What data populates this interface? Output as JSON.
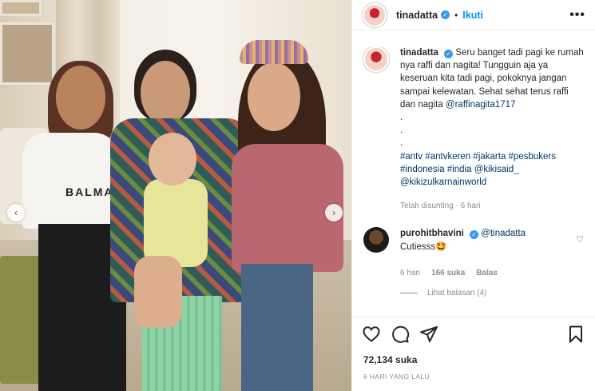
{
  "post": {
    "username": "tinadatta",
    "follow_label": "Ikuti",
    "more_glyph": "•••",
    "dot": "•",
    "verified_glyph": "✓",
    "image": {
      "shirt_text": "BALMAIN",
      "prev_glyph": "‹",
      "next_glyph": "›"
    }
  },
  "caption": {
    "username": "tinadatta",
    "text": "Seru banget tadi pagi ke rumah nya raffi dan nagita! Tungguin aja ya keseruan kita tadi pagi, pokoknya jangan sampai kelewatan. Sehat sehat terus raffi dan nagita ",
    "mention": "@raffinagita1717",
    "dots": [
      ".",
      ".",
      "."
    ],
    "hashtags_line1": "#antv #antvkeren #jakarta #pesbukers",
    "hashtags_line2": "#indonesia #india @kikisaid_",
    "hashtags_line3": "@kikizulkarnainworld",
    "meta": "Telah disunting · 6 hari"
  },
  "reply": {
    "username": "purohitbhavini",
    "mention": "@tinadatta",
    "text": "Cutiesss🤩",
    "time": "6 hari",
    "likes": "166 suka",
    "reply_label": "Balas",
    "heart_glyph": "♡",
    "view_replies": "Lihat balasan (4)"
  },
  "footer": {
    "likes": "72,134 suka",
    "timestamp": "6 HARI YANG LALU"
  },
  "icons": [
    "heart-icon",
    "comment-icon",
    "share-icon",
    "bookmark-icon"
  ],
  "colors": {
    "accent": "#0095f6",
    "verified": "#3897f0",
    "muted": "#8e8e8e",
    "link": "#00376b"
  }
}
